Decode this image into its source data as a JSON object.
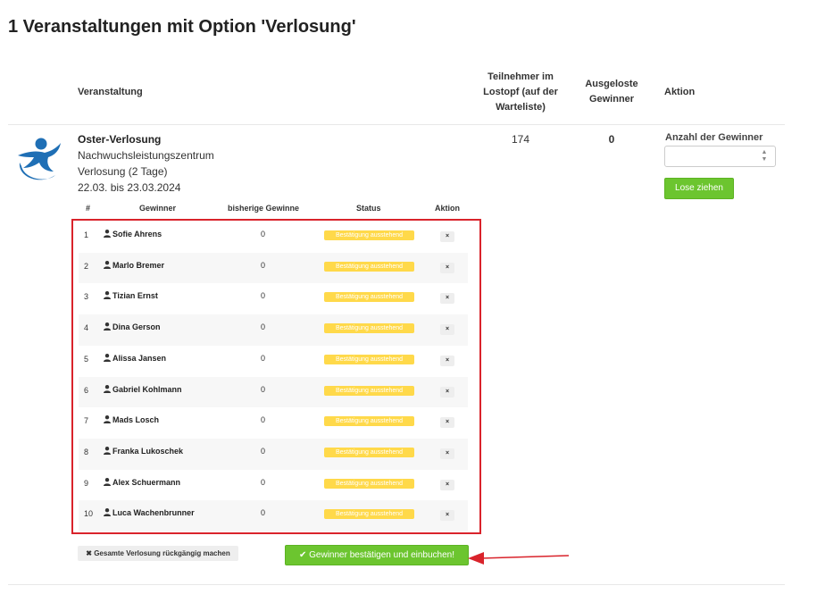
{
  "page": {
    "title": "1 Veranstaltungen mit Option 'Verlosung'"
  },
  "table": {
    "headers": {
      "event": "Veranstaltung",
      "participants_l1": "Teilnehmer im",
      "participants_l2": "Lostopf (auf der",
      "participants_l3": "Warteliste)",
      "winners_l1": "Ausgeloste",
      "winners_l2": "Gewinner",
      "action": "Aktion"
    }
  },
  "event": {
    "name": "Oster-Verlosung",
    "location": "Nachwuchsleistungszentrum",
    "type": "Verlosung (2 Tage)",
    "dates": "22.03. bis 23.03.2024",
    "participants": "174",
    "drawn_winners": "0",
    "logo_icon": "person-running-logo-icon"
  },
  "draw": {
    "count_label": "Anzahl der Gewinner",
    "count_value": "",
    "draw_button": "Lose ziehen"
  },
  "winners_table": {
    "headers": {
      "idx": "#",
      "winner": "Gewinner",
      "prev": "bisherige Gewinne",
      "status": "Status",
      "action": "Aktion"
    },
    "rows": [
      {
        "idx": "1",
        "name": "Sofie Ahrens",
        "prev": "0",
        "status": "Bestätigung ausstehend",
        "remove": "×"
      },
      {
        "idx": "2",
        "name": "Marlo Bremer",
        "prev": "0",
        "status": "Bestätigung ausstehend",
        "remove": "×"
      },
      {
        "idx": "3",
        "name": "Tizian Ernst",
        "prev": "0",
        "status": "Bestätigung ausstehend",
        "remove": "×"
      },
      {
        "idx": "4",
        "name": "Dina Gerson",
        "prev": "0",
        "status": "Bestätigung ausstehend",
        "remove": "×"
      },
      {
        "idx": "5",
        "name": "Alissa Jansen",
        "prev": "0",
        "status": "Bestätigung ausstehend",
        "remove": "×"
      },
      {
        "idx": "6",
        "name": "Gabriel Kohlmann",
        "prev": "0",
        "status": "Bestätigung ausstehend",
        "remove": "×"
      },
      {
        "idx": "7",
        "name": "Mads Losch",
        "prev": "0",
        "status": "Bestätigung ausstehend",
        "remove": "×"
      },
      {
        "idx": "8",
        "name": "Franka Lukoschek",
        "prev": "0",
        "status": "Bestätigung ausstehend",
        "remove": "×"
      },
      {
        "idx": "9",
        "name": "Alex Schuermann",
        "prev": "0",
        "status": "Bestätigung ausstehend",
        "remove": "×"
      },
      {
        "idx": "10",
        "name": "Luca Wachenbrunner",
        "prev": "0",
        "status": "Bestätigung ausstehend",
        "remove": "×"
      }
    ]
  },
  "actions": {
    "undo_all": "✖ Gesamte Verlosung rückgängig machen",
    "confirm": "✔ Gewinner bestätigen und einbuchen!"
  },
  "colors": {
    "accent_green": "#6cc52f",
    "status_yellow": "#ffd94a",
    "highlight_red": "#d9232b",
    "logo_blue": "#1f6fb5"
  }
}
